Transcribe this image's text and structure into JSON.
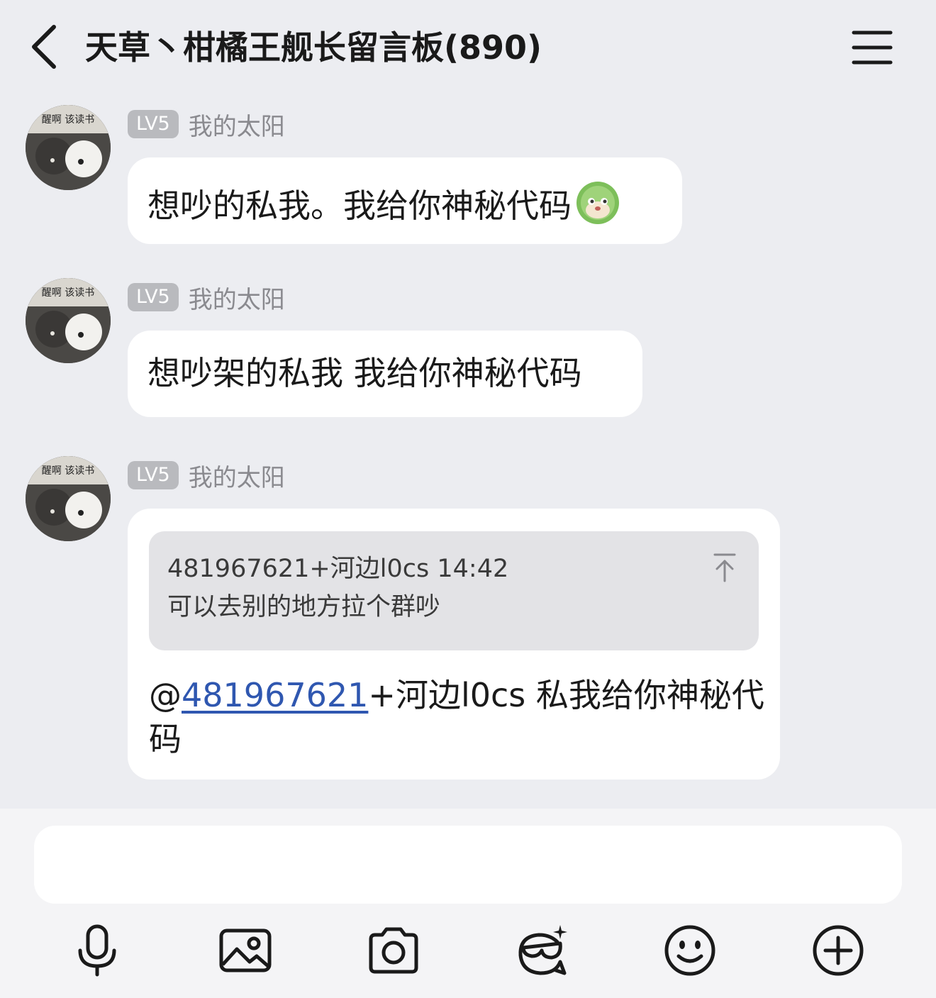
{
  "header": {
    "title": "天草丶柑橘王舰长留言板(890)"
  },
  "messages": [
    {
      "level": "LV5",
      "nickname": "我的太阳",
      "avatar_caption": "醒啊 该读书",
      "text": "想吵的私我。我给你神秘代码",
      "emoji": "green-dog-emoji"
    },
    {
      "level": "LV5",
      "nickname": "我的太阳",
      "avatar_caption": "醒啊 该读书",
      "text": "想吵架的私我 我给你神秘代码"
    },
    {
      "level": "LV5",
      "nickname": "我的太阳",
      "avatar_caption": "醒啊 该读书",
      "quote": {
        "author": "481967621+河边l0cs",
        "time": "14:42",
        "text": "可以去别的地方拉个群吵"
      },
      "reply": {
        "at_sign": "@",
        "mention": "481967621",
        "rest": "+河边l0cs 私我给你神秘代码"
      }
    }
  ],
  "composer": {
    "value": "",
    "placeholder": ""
  },
  "toolbar": [
    "microphone-icon",
    "image-icon",
    "camera-icon",
    "mask-sticker-icon",
    "smiley-icon",
    "plus-circle-icon"
  ],
  "colors": {
    "background": "#ECEDF1",
    "bubble": "#FFFFFF",
    "level_badge": "#B9BABE",
    "mention": "#2F57B0"
  }
}
